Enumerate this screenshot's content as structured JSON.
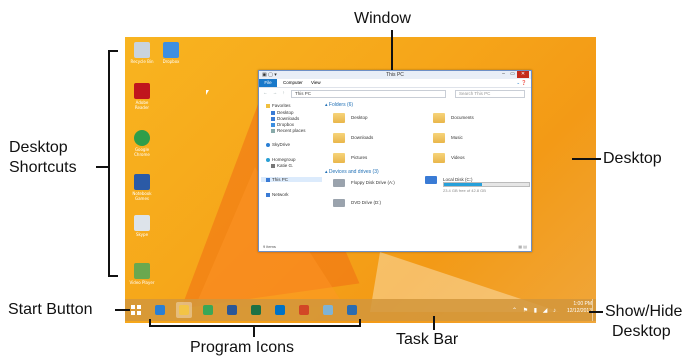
{
  "annotations": {
    "window": "Window",
    "desktop_shortcuts_1": "Desktop",
    "desktop_shortcuts_2": "Shortcuts",
    "desktop": "Desktop",
    "start_button": "Start Button",
    "program_icons": "Program Icons",
    "task_bar": "Task Bar",
    "show_hide_1": "Show/Hide",
    "show_hide_2": "Desktop"
  },
  "desktop_icons": [
    {
      "label": "Recycle Bin",
      "icon": "recycle-bin-icon",
      "color": "#c9d3de"
    },
    {
      "label": "Dropbox",
      "icon": "dropbox-icon",
      "color": "#3d8fe0"
    },
    {
      "label": "Adobe Reader",
      "icon": "adobe-reader-icon",
      "color": "#c0151d"
    },
    {
      "label": "Google Chrome",
      "icon": "chrome-icon",
      "color": "#2f9e4a"
    },
    {
      "label": "Notebook Games",
      "icon": "games-icon",
      "color": "#2b5aa6"
    },
    {
      "label": "Skype",
      "icon": "skype-icon",
      "color": "#dde3ea"
    },
    {
      "label": "Video Player",
      "icon": "video-player-icon",
      "color": "#6aa84f"
    }
  ],
  "window": {
    "title": "This PC",
    "ribbon_tabs": [
      "File",
      "Computer",
      "View"
    ],
    "address": "This PC",
    "search_placeholder": "Search This PC",
    "nav": {
      "favorites": "Favorites",
      "desktop": "Desktop",
      "downloads": "Downloads",
      "dropbox": "Dropbox",
      "recent": "Recent places",
      "skydrive": "SkyDrive",
      "homegroup": "Homegroup",
      "user": "Katie G.",
      "thispc": "This PC",
      "network": "Network"
    },
    "folders_header": "Folders (6)",
    "folders": [
      "Desktop",
      "Documents",
      "Downloads",
      "Music",
      "Pictures",
      "Videos"
    ],
    "devices_header": "Devices and drives (3)",
    "drives": {
      "floppy": "Floppy Disk Drive (A:)",
      "local": "Local Disk (C:)",
      "local_space": "23.4 GB free of 42.8 GB",
      "local_used_fraction": 0.45,
      "dvd": "DVD Drive (D:)"
    },
    "status": "9 items"
  },
  "taskbar": {
    "programs": [
      {
        "icon": "internet-explorer-icon",
        "color": "#2a7fd4"
      },
      {
        "icon": "file-explorer-icon",
        "color": "#f3c445"
      },
      {
        "icon": "chrome-icon",
        "color": "#3aa757"
      },
      {
        "icon": "word-icon",
        "color": "#2b5797"
      },
      {
        "icon": "excel-icon",
        "color": "#1e7145"
      },
      {
        "icon": "outlook-icon",
        "color": "#0072c6"
      },
      {
        "icon": "powerpoint-icon",
        "color": "#d24726"
      },
      {
        "icon": "photo-icon",
        "color": "#7fb3d5"
      },
      {
        "icon": "lync-icon",
        "color": "#2b6cb0"
      }
    ],
    "time": "1:00 PM",
    "date": "12/12/2013"
  }
}
